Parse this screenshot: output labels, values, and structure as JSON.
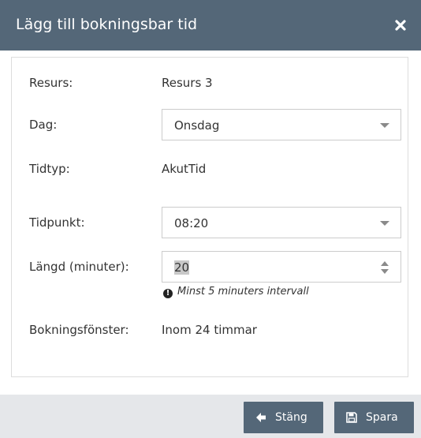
{
  "dialog": {
    "title": "Lägg till bokningsbar tid"
  },
  "form": {
    "resurs": {
      "label": "Resurs:",
      "value": "Resurs 3"
    },
    "dag": {
      "label": "Dag:",
      "value": "Onsdag"
    },
    "tidtyp": {
      "label": "Tidtyp:",
      "value": "AkutTid"
    },
    "tidpunkt": {
      "label": "Tidpunkt:",
      "value": "08:20"
    },
    "langd": {
      "label": "Längd (minuter):",
      "value": "20",
      "hint": "Minst 5 minuters intervall"
    },
    "bokningsfonster": {
      "label": "Bokningsfönster:",
      "value": "Inom 24 timmar"
    }
  },
  "footer": {
    "close_label": "Stäng",
    "save_label": "Spara"
  },
  "colors": {
    "header_bg": "#546778",
    "button_bg": "#546778",
    "footer_bg": "#e5e7ea",
    "panel_border": "#dddddd"
  },
  "icons": {
    "close": "close-icon",
    "info": "info-circle-icon",
    "back": "arrow-left-icon",
    "save": "floppy-disk-icon"
  }
}
